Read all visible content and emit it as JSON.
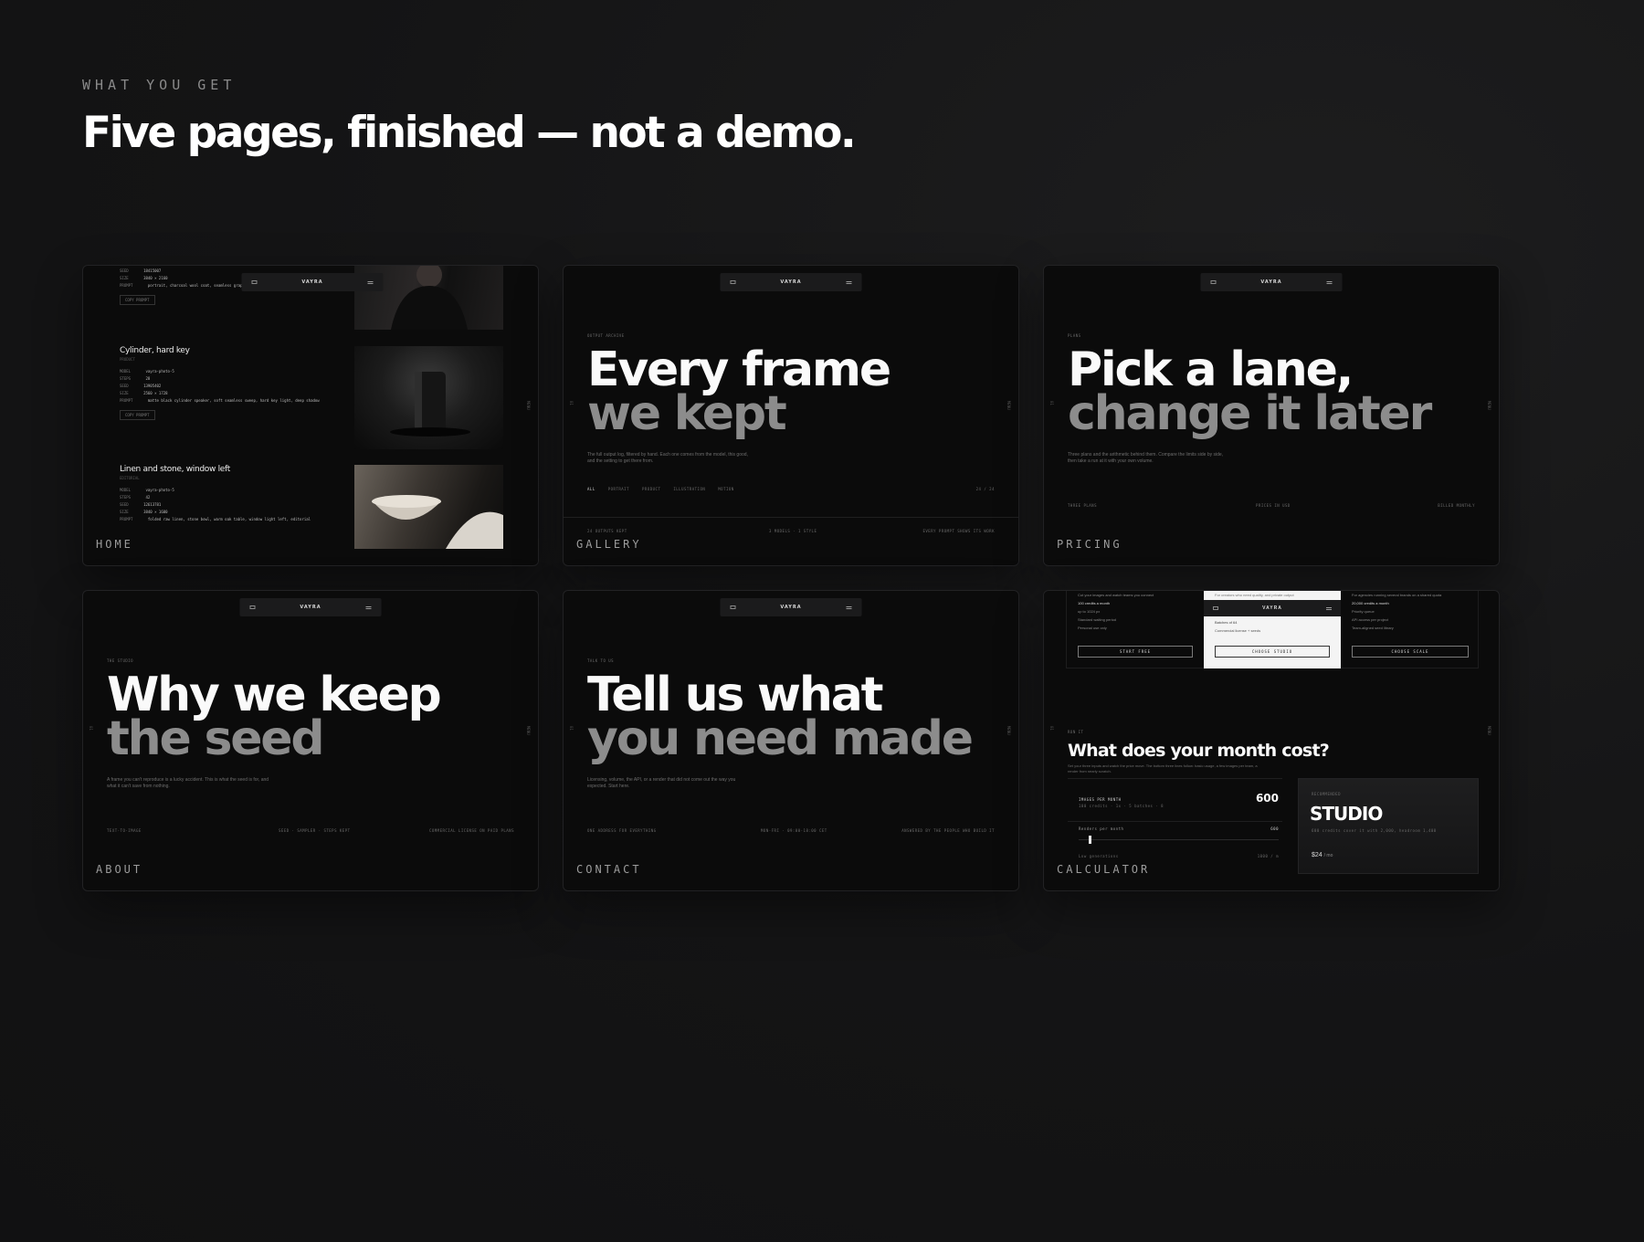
{
  "header": {
    "eyebrow": "WHAT YOU GET",
    "title": "Five pages, finished — not a demo."
  },
  "mini_nav": {
    "brand": "VAYRA"
  },
  "cards": {
    "home": {
      "label": "HOME",
      "items": [
        {
          "title": "Cylinder, hard key",
          "subtitle": "PRODUCT",
          "meta": [
            {
              "k": "MODEL",
              "v": "vayra-photo-5"
            },
            {
              "k": "STEPS",
              "v": "28"
            },
            {
              "k": "SEED",
              "v": "13905402"
            },
            {
              "k": "SIZE",
              "v": "2560 × 1728"
            },
            {
              "k": "PROMPT",
              "v": "matte black cylinder speaker, soft seamless sweep, hard key light, deep shadow"
            }
          ],
          "button": "COPY PROMPT"
        },
        {
          "title": "Linen and stone, window left",
          "subtitle": "EDITORIAL",
          "meta": [
            {
              "k": "MODEL",
              "v": "vayra-photo-5"
            },
            {
              "k": "STEPS",
              "v": "42"
            },
            {
              "k": "SEED",
              "v": "12613781"
            },
            {
              "k": "SIZE",
              "v": "3840 × 1600"
            },
            {
              "k": "PROMPT",
              "v": "folded raw linen, stone bowl, warm oak table, window light left, editorial"
            }
          ],
          "button": "COPY PROMPT"
        }
      ],
      "top_meta": [
        {
          "k": "SEED",
          "v": "18415007"
        },
        {
          "k": "SIZE",
          "v": "3840 × 2160"
        },
        {
          "k": "PROMPT",
          "v": "portrait, charcoal wool coat, seamless graphite,"
        }
      ],
      "top_button": "COPY PROMPT"
    },
    "gallery": {
      "label": "GALLERY",
      "eyebrow": "OUTPUT ARCHIVE",
      "line1": "Every frame",
      "line2": "we kept",
      "para": "The full output log, filtered by hand. Each one comes from the model, this good, and the setting to get there from.",
      "filters": [
        "ALL",
        "PORTRAIT",
        "PRODUCT",
        "ILLUSTRATION",
        "MOTION"
      ],
      "count": "24 / 24",
      "footer": [
        "24 OUTPUTS KEPT",
        "3 MODELS · 1 STYLE",
        "EVERY PROMPT SHOWS ITS WORK"
      ]
    },
    "pricing": {
      "label": "PRICING",
      "eyebrow": "PLANS",
      "line1": "Pick a lane,",
      "line2": "change it later",
      "para": "Three plans and the arithmetic behind them. Compare the limits side by side, then take a run at it with your own volume.",
      "footer": [
        "THREE PLANS",
        "PRICES IN USD",
        "BILLED MONTHLY"
      ]
    },
    "about": {
      "label": "ABOUT",
      "eyebrow": "THE STUDIO",
      "line1": "Why we keep",
      "line2": "the seed",
      "para": "A frame you can't reproduce is a lucky accident. This is what the seed is for, and what it can't save from nothing.",
      "footer": [
        "TEXT-TO-IMAGE",
        "SEED · SAMPLER · STEPS KEPT",
        "COMMERCIAL LICENSE ON PAID PLANS"
      ]
    },
    "contact": {
      "label": "CONTACT",
      "eyebrow": "TALK TO US",
      "line1": "Tell us what",
      "line2": "you need made",
      "para": "Licensing, volume, the API, or a render that did not come out the way you expected. Start here.",
      "footer": [
        "ONE ADDRESS FOR EVERYTHING",
        "MON-FRI · 09:00-18:00 CET",
        "ANSWERED BY THE PEOPLE WHO BUILD IT"
      ]
    },
    "calculator": {
      "label": "CALCULATOR",
      "eyebrow": "RUN IT",
      "title": "What does your month cost?",
      "para": "Set your three inputs and watch the price move. The bottom three lines follow: basic usage, a few images per team, a render from nearly scratch.",
      "plans": [
        {
          "lines": [
            "Cut your images and watch teams you connect",
            "100 credits a month",
            "up to 1024 px",
            "Standard waiting period",
            "Personal use only"
          ],
          "button": "START FREE",
          "featured": false
        },
        {
          "lines": [
            "For creators who need quality, and private output",
            "Batches of 64",
            "Commercial license + seeds"
          ],
          "button": "CHOOSE STUDIO",
          "featured": true
        },
        {
          "lines": [
            "For agencies running several brands on a shared quota",
            "20,000 credits a month",
            "Priority queue",
            "API access per project",
            "Team-aligned seed library"
          ],
          "button": "CHOOSE SCALE",
          "featured": false
        }
      ],
      "images_label": "IMAGES PER MONTH",
      "images_hint": "100 credits · 1x · 5 batches · 8",
      "images_value": "600",
      "renders_label": "Renders per month",
      "renders_value": "600",
      "slider_min": "Low generations",
      "slider_max": "1000 / m",
      "slider_fraction": 0.05,
      "result_eyebrow": "RECOMMENDED",
      "result_plan": "STUDIO",
      "result_note": "600 credits cover it with 2,000, headroom 1,400",
      "result_price": "$24",
      "result_period": "/ mo"
    }
  },
  "colors": {
    "background": "#141415",
    "card": "#0b0b0b",
    "accent_white": "#ffffff",
    "muted_gray": "#8c8c8c"
  }
}
